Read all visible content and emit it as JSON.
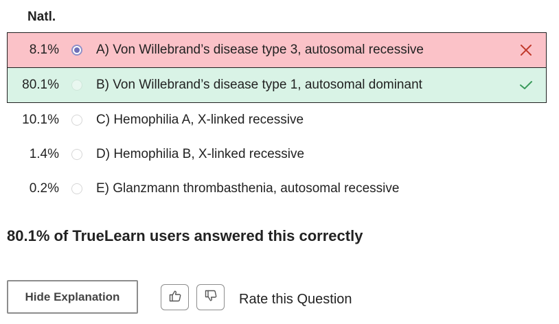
{
  "header": {
    "natl_label": "Natl."
  },
  "choices": [
    {
      "pct": "8.1%",
      "text": "A) Von Willebrand’s disease type 3, autosomal recessive",
      "state": "wrong",
      "selected": true
    },
    {
      "pct": "80.1%",
      "text": "B) Von Willebrand’s disease type 1, autosomal dominant",
      "state": "correct",
      "selected": false
    },
    {
      "pct": "10.1%",
      "text": "C) Hemophilia A, X-linked recessive",
      "state": "neutral",
      "selected": false
    },
    {
      "pct": "1.4%",
      "text": "D) Hemophilia B, X-linked recessive",
      "state": "neutral",
      "selected": false
    },
    {
      "pct": "0.2%",
      "text": "E) Glanzmann thrombasthenia, autosomal recessive",
      "state": "neutral",
      "selected": false
    }
  ],
  "summary": "80.1% of TrueLearn users answered this correctly",
  "footer": {
    "hide_explanation_label": "Hide Explanation",
    "rate_label": "Rate this Question"
  },
  "icons": {
    "wrong_mark": "x-icon",
    "correct_mark": "check-icon",
    "thumbs_up": "thumbs-up-icon",
    "thumbs_down": "thumbs-down-icon"
  },
  "colors": {
    "wrong_bg": "#fbc2c8",
    "correct_bg": "#d9f3e6",
    "wrong_mark": "#c0392b",
    "correct_mark": "#3a9a5b",
    "selected_radio": "#6f70b8"
  }
}
